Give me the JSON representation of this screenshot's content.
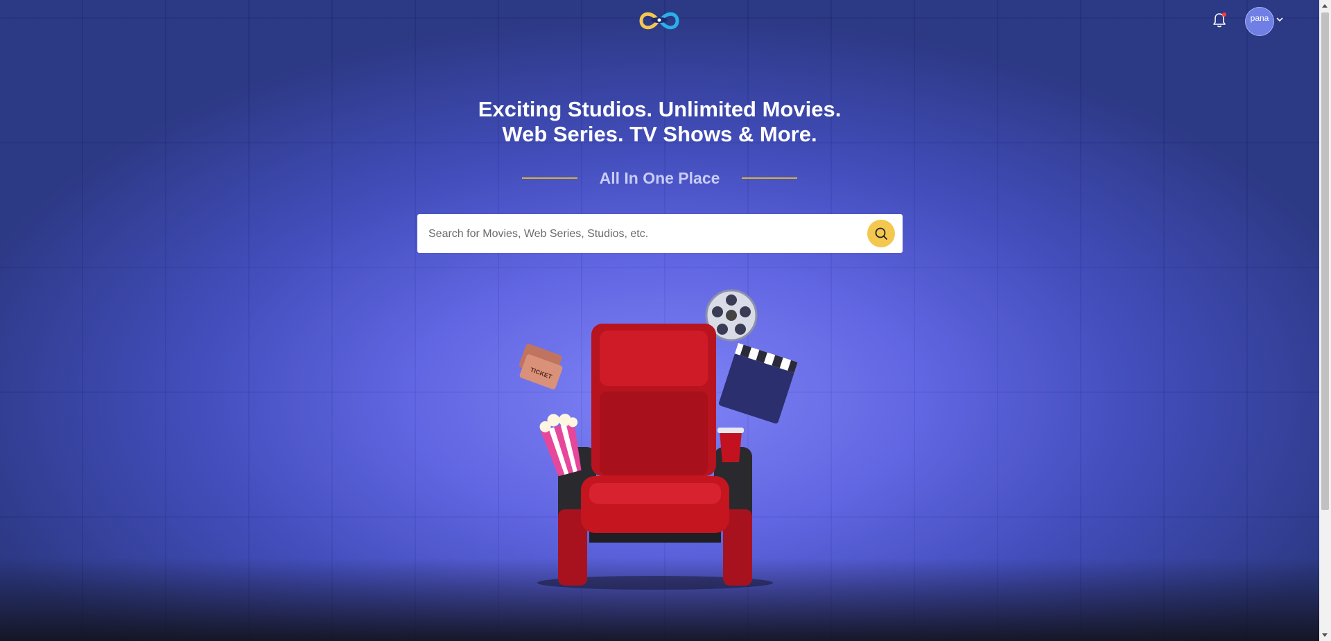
{
  "header": {
    "logo": {
      "icon": "infinity-eye-logo-icon",
      "colors": [
        "#f4c84f",
        "#2ab0e8",
        "#1e2a6e"
      ]
    },
    "notifications": {
      "icon": "bell-icon",
      "has_unread": true
    },
    "user_menu": {
      "avatar_text": "pana",
      "icon": "chevron-down-icon"
    }
  },
  "hero": {
    "title_line1": "Exciting Studios. Unlimited Movies.",
    "title_line2": "Web Series. TV Shows & More.",
    "tagline": "All In One Place"
  },
  "search": {
    "placeholder": "Search for Movies, Web Series, Studios, etc.",
    "value": "",
    "button_icon": "search-icon"
  },
  "illustration": {
    "items": [
      "cinema-seat",
      "film-reel",
      "clapperboard",
      "tickets",
      "popcorn",
      "drink-cup"
    ]
  },
  "colors": {
    "accent": "#f4c84f",
    "background": "#4a55d0",
    "tagline_line": "#d8b23a"
  }
}
